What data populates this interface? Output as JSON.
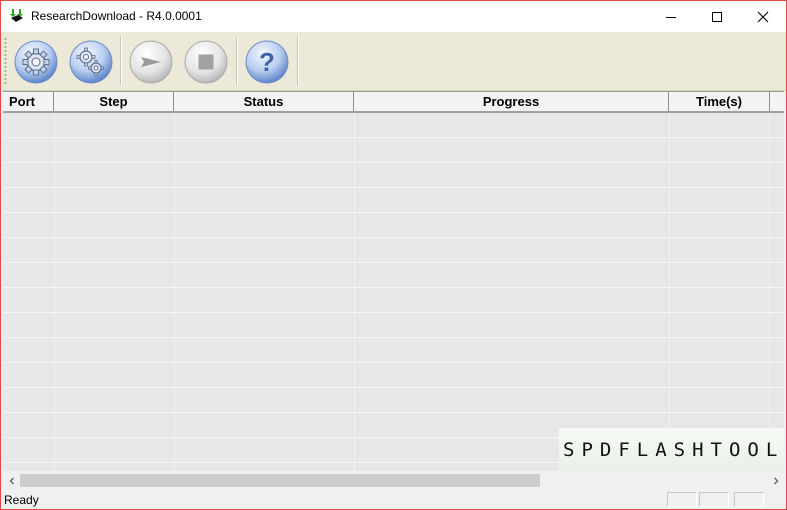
{
  "window": {
    "title": "ResearchDownload - R4.0.0001",
    "controls": [
      "minimize-icon",
      "maximize-icon",
      "close-icon"
    ]
  },
  "toolbar": {
    "buttons": [
      {
        "icon": "gear-icon",
        "enabled": true
      },
      {
        "icon": "gears-icon",
        "enabled": true
      },
      {
        "icon": "play-arrow-icon",
        "enabled": false
      },
      {
        "icon": "stop-square-icon",
        "enabled": false
      },
      {
        "icon": "question-mark-icon",
        "enabled": true
      }
    ]
  },
  "grid": {
    "columns": [
      "Port",
      "Step",
      "Status",
      "Progress",
      "Time(s)"
    ],
    "rows": []
  },
  "watermark": "SPDFLASHTOOL.COM",
  "statusbar": {
    "text": "Ready"
  },
  "colors": {
    "window_border": "#e04848",
    "toolbar_bg": "#ece9d8",
    "button_blue": "#6a93d6",
    "grid_bg": "#e7e7e7"
  }
}
